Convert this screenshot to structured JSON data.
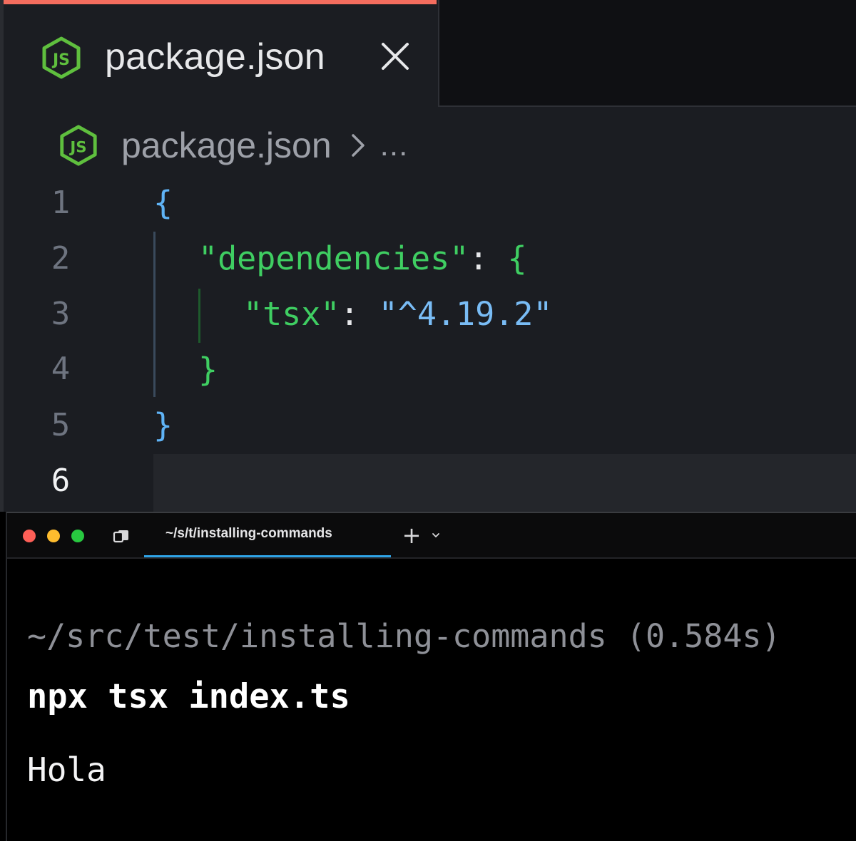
{
  "editor": {
    "tab": {
      "title": "package.json",
      "icon": "nodejs-icon",
      "close_icon": "close-icon",
      "accent_color": "#f46d5e"
    },
    "breadcrumb": {
      "file": "package.json",
      "separator_icon": "chevron-right-icon",
      "more": "..."
    },
    "line_numbers": [
      "1",
      "2",
      "3",
      "4",
      "5",
      "6"
    ],
    "active_line": "6",
    "code": {
      "line1": {
        "brace": "{"
      },
      "line2": {
        "quote_open": "\"",
        "key": "dependencies",
        "quote_close": "\"",
        "colon": ": ",
        "brace": "{"
      },
      "line3": {
        "quote_open": "\"",
        "key": "tsx",
        "quote_close": "\"",
        "colon": ": ",
        "value": "\"^4.19.2\""
      },
      "line4": {
        "brace": "}"
      },
      "line5": {
        "brace": "}"
      }
    },
    "colors": {
      "background": "#1b1d22",
      "brace_outer": "#5fb3f6",
      "brace_inner": "#3fce62",
      "key": "#3fce62",
      "string": "#79bcf5"
    }
  },
  "terminal": {
    "tab": {
      "title": "~/s/t/installing-commands",
      "icon": "folder-tab-icon",
      "new_tab_label": "+",
      "dropdown_icon": "chevron-down-icon"
    },
    "traffic_lights": {
      "close_color": "#fe5f57",
      "minimize_color": "#febc2e",
      "zoom_color": "#28c840"
    },
    "block": {
      "cwd": "~/src/test/installing-commands (0.584s)",
      "command": "npx tsx index.ts",
      "output": "Hola"
    }
  }
}
